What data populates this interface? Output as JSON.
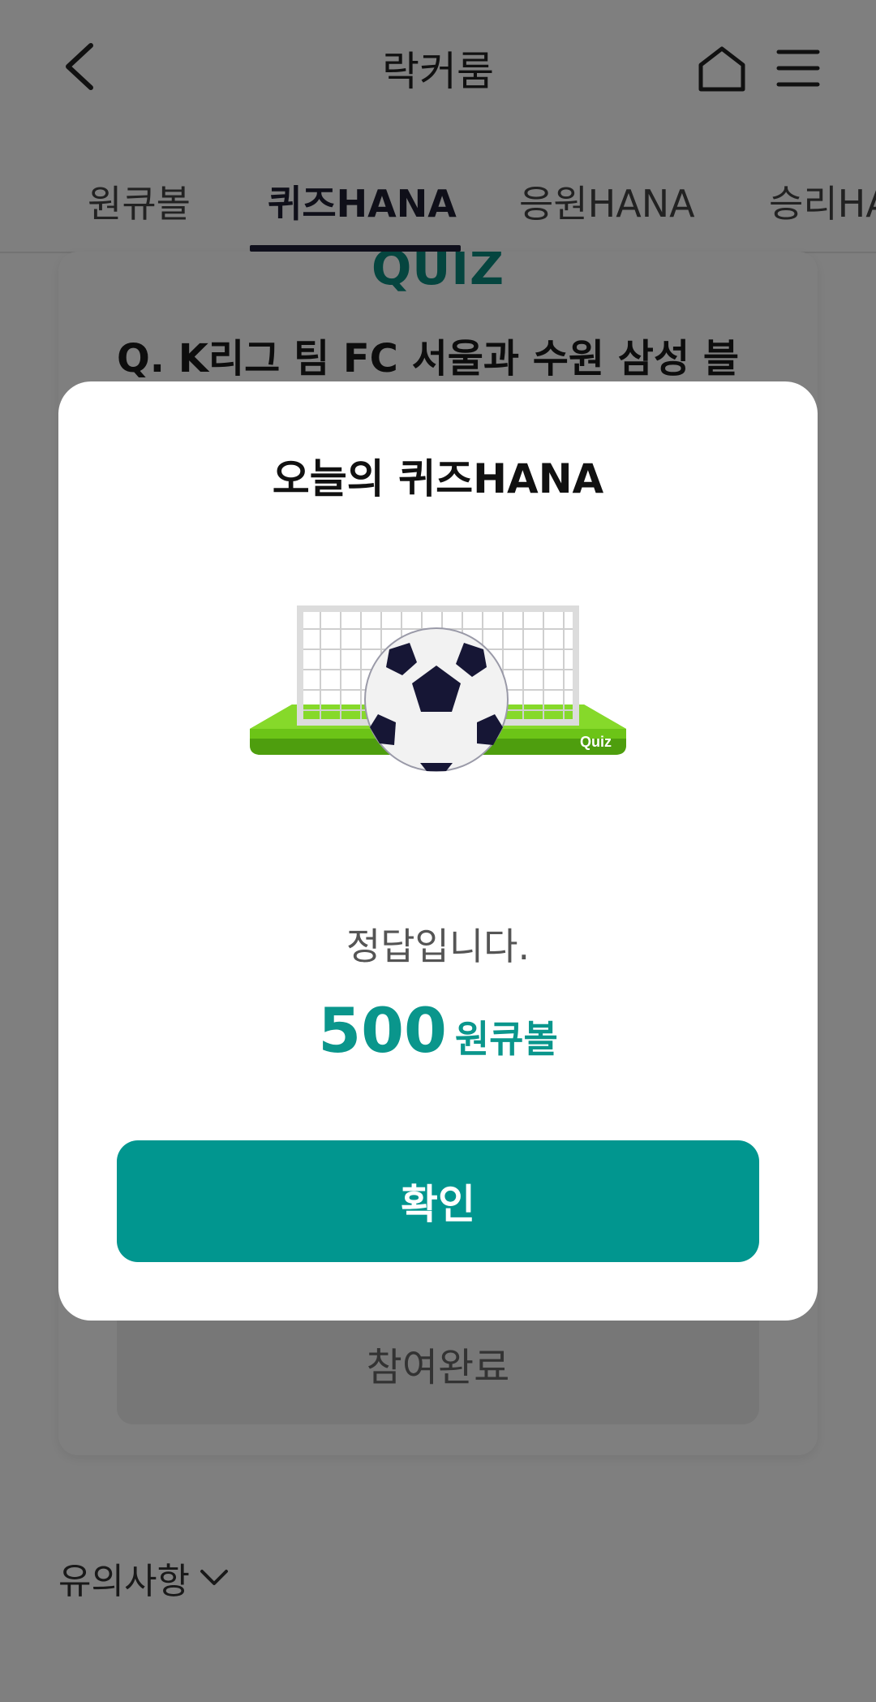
{
  "header": {
    "title": "락커룸",
    "back_icon": "chevron-left-icon",
    "home_icon": "home-icon",
    "menu_icon": "hamburger-menu-icon"
  },
  "tabs": [
    {
      "label": "원큐볼",
      "active": false
    },
    {
      "label": "퀴즈HANA",
      "active": true
    },
    {
      "label": "응원HANA",
      "active": false
    },
    {
      "label": "승리HA",
      "active": false
    }
  ],
  "quiz_card": {
    "heading": "QUIZ",
    "question": "Q. K리그 팀 FC 서울과 수원 삼성 블",
    "submit_label": "참여완료"
  },
  "notice": {
    "label": "유의사항",
    "icon": "chevron-down-icon"
  },
  "modal": {
    "title": "오늘의 퀴즈HANA",
    "illustration_text": "Quiz",
    "result_text": "정답입니다.",
    "reward_amount": "500",
    "reward_unit": "원큐볼",
    "confirm_label": "확인"
  },
  "colors": {
    "accent": "#01968f",
    "quiz_heading": "#0a8a7f",
    "overlay": "rgba(0,0,0,0.5)"
  }
}
